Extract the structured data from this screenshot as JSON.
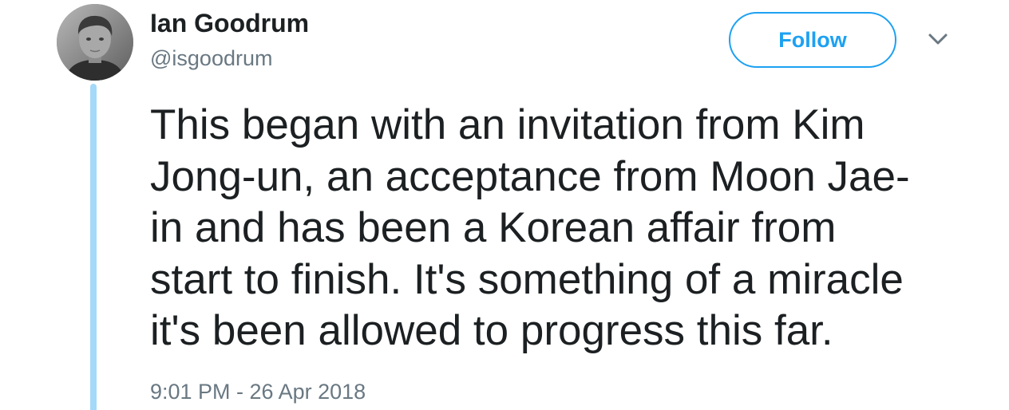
{
  "author": {
    "name": "Ian Goodrum",
    "handle": "@isgoodrum",
    "avatar_icon": "user-avatar-photo"
  },
  "actions": {
    "follow_label": "Follow",
    "menu_icon": "chevron-down-icon"
  },
  "tweet": {
    "lines": [
      "This began with an invitation from Kim",
      "Jong-un, an acceptance from Moon Jae-",
      "in and has been a Korean affair from",
      "start to finish. It's something of a miracle",
      "it's been allowed to progress this far."
    ],
    "timestamp": "9:01 PM - 26 Apr 2018"
  },
  "colors": {
    "accent": "#1da1f2",
    "thread_line": "#a4d9f9",
    "text": "#1c2022",
    "secondary_text": "#697882"
  }
}
